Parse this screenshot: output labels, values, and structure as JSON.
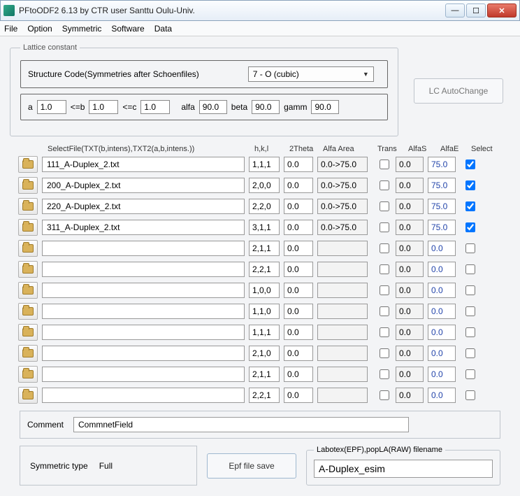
{
  "window": {
    "title": "PFtoODF2 6.13 by CTR user Santtu Oulu-Univ."
  },
  "menu": [
    "File",
    "Option",
    "Symmetric",
    "Software",
    "Data"
  ],
  "lattice": {
    "legend": "Lattice constant",
    "struct_label": "Structure Code(Symmetries after Schoenfiles)",
    "struct_value": "7 - O (cubic)",
    "a_label": "a",
    "a_val": "1.0",
    "leb_label": "<=b",
    "b_val": "1.0",
    "lec_label": "<=c",
    "c_val": "1.0",
    "alfa_label": "alfa",
    "alfa_val": "90.0",
    "beta_label": "beta",
    "beta_val": "90.0",
    "gamm_label": "gamm",
    "gamm_val": "90.0"
  },
  "lc_auto": "LC AutoChange",
  "pf_header": {
    "selectfile": "SelectFile(TXT(b,intens),TXT2(a,b,intens.))",
    "hkl": "h,k,l",
    "theta": "2Theta",
    "alfa": "Alfa Area",
    "trans": "Trans",
    "alfas": "AlfaS",
    "alfae": "AlfaE",
    "select": "Select"
  },
  "rows": [
    {
      "file": "111_A-Duplex_2.txt",
      "hkl": "1,1,1",
      "theta": "0.0",
      "alfa": "0.0->75.0",
      "trans": false,
      "as": "0.0",
      "ae": "75.0",
      "sel": true
    },
    {
      "file": "200_A-Duplex_2.txt",
      "hkl": "2,0,0",
      "theta": "0.0",
      "alfa": "0.0->75.0",
      "trans": false,
      "as": "0.0",
      "ae": "75.0",
      "sel": true
    },
    {
      "file": "220_A-Duplex_2.txt",
      "hkl": "2,2,0",
      "theta": "0.0",
      "alfa": "0.0->75.0",
      "trans": false,
      "as": "0.0",
      "ae": "75.0",
      "sel": true
    },
    {
      "file": "311_A-Duplex_2.txt",
      "hkl": "3,1,1",
      "theta": "0.0",
      "alfa": "0.0->75.0",
      "trans": false,
      "as": "0.0",
      "ae": "75.0",
      "sel": true
    },
    {
      "file": "",
      "hkl": "2,1,1",
      "theta": "0.0",
      "alfa": "",
      "trans": false,
      "as": "0.0",
      "ae": "0.0",
      "sel": false
    },
    {
      "file": "",
      "hkl": "2,2,1",
      "theta": "0.0",
      "alfa": "",
      "trans": false,
      "as": "0.0",
      "ae": "0.0",
      "sel": false
    },
    {
      "file": "",
      "hkl": "1,0,0",
      "theta": "0.0",
      "alfa": "",
      "trans": false,
      "as": "0.0",
      "ae": "0.0",
      "sel": false
    },
    {
      "file": "",
      "hkl": "1,1,0",
      "theta": "0.0",
      "alfa": "",
      "trans": false,
      "as": "0.0",
      "ae": "0.0",
      "sel": false
    },
    {
      "file": "",
      "hkl": "1,1,1",
      "theta": "0.0",
      "alfa": "",
      "trans": false,
      "as": "0.0",
      "ae": "0.0",
      "sel": false
    },
    {
      "file": "",
      "hkl": "2,1,0",
      "theta": "0.0",
      "alfa": "",
      "trans": false,
      "as": "0.0",
      "ae": "0.0",
      "sel": false
    },
    {
      "file": "",
      "hkl": "2,1,1",
      "theta": "0.0",
      "alfa": "",
      "trans": false,
      "as": "0.0",
      "ae": "0.0",
      "sel": false
    },
    {
      "file": "",
      "hkl": "2,2,1",
      "theta": "0.0",
      "alfa": "",
      "trans": false,
      "as": "0.0",
      "ae": "0.0",
      "sel": false
    }
  ],
  "comment": {
    "label": "Comment",
    "value": "CommnetField"
  },
  "sym": {
    "label": "Symmetric type",
    "value": "Full"
  },
  "epf_btn": "Epf file save",
  "labotex": {
    "legend": "Labotex(EPF),popLA(RAW) filename",
    "value": "A-Duplex_esim"
  }
}
